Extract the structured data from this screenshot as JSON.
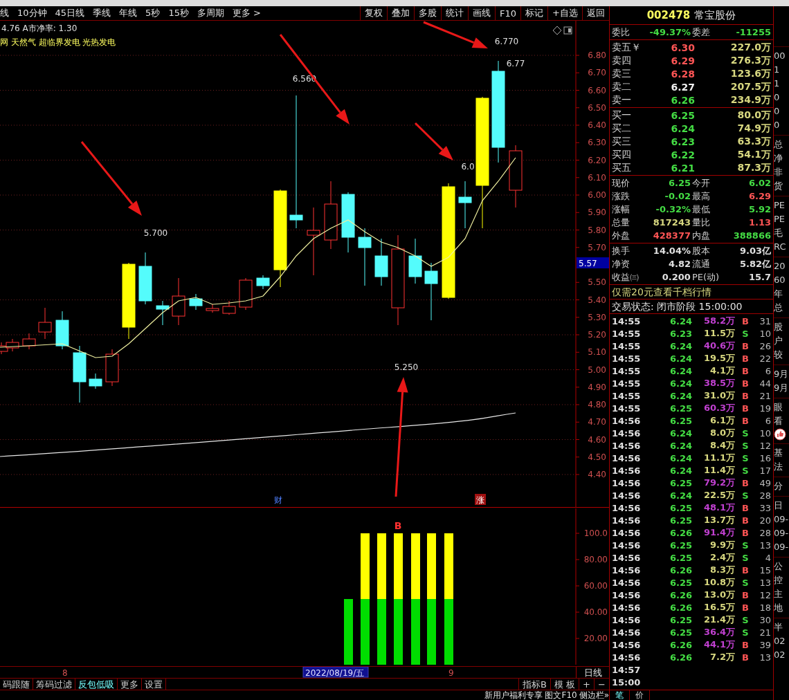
{
  "toolbar": {
    "periods": [
      "线",
      "10分钟",
      "45日线",
      "季线",
      "年线",
      "5秒",
      "15秒",
      "多周期",
      "更多 >"
    ],
    "buttons": [
      "复权",
      "叠加",
      "多股",
      "统计",
      "画线",
      "F10",
      "标记",
      "+自选",
      "返回"
    ]
  },
  "chart": {
    "info_line": "4.76 A市净率: 1.30",
    "concept_line": "网 天然气 超临界发电 光热发电",
    "price_axis": [
      "6.80",
      "6.70",
      "6.60",
      "6.50",
      "6.40",
      "6.30",
      "6.20",
      "6.10",
      "6.00",
      "5.90",
      "5.80",
      "5.70",
      "5.50",
      "5.40",
      "5.30",
      "5.20",
      "5.10",
      "5.00",
      "4.90",
      "4.80",
      "4.70",
      "4.60",
      "4.50",
      "4.40"
    ],
    "current_price_tag": "5.57",
    "annotations": [
      {
        "text": "5.700",
        "kind": "price"
      },
      {
        "text": "6.560",
        "kind": "price"
      },
      {
        "text": "6.770",
        "kind": "price"
      },
      {
        "text": "6.77",
        "kind": "price"
      },
      {
        "text": "6.0",
        "kind": "price"
      },
      {
        "text": "5.250",
        "kind": "price"
      }
    ],
    "event_marks": [
      {
        "text": "财",
        "kind": "info"
      },
      {
        "text": "涨",
        "kind": "alert"
      }
    ]
  },
  "indicator": {
    "signal_mark": "B",
    "axis_labels": [
      "100.0",
      "80.00",
      "60.00",
      "40.00",
      "20.00"
    ]
  },
  "time_axis": {
    "labels": [
      "8",
      "2022/08/19/五",
      "9"
    ],
    "period_button": "日线"
  },
  "bottom_tabs": [
    {
      "label": "码跟随",
      "selected": false
    },
    {
      "label": "筹码过滤",
      "selected": false
    },
    {
      "label": "反包低吸",
      "selected": true
    },
    {
      "label": "更多",
      "selected": false
    },
    {
      "label": "设置",
      "selected": false
    }
  ],
  "bottom_right_buttons": [
    "指标B",
    "模 板",
    "+",
    "−"
  ],
  "footer_links": [
    "新用户福利专享",
    "图文F10",
    "侧边栏»"
  ],
  "quote": {
    "code": "002478",
    "name": "常宝股份",
    "ratio": [
      {
        "label": "委比",
        "value": "-49.37%",
        "color": "#44dd44"
      },
      {
        "label": "委差",
        "value": "-11255",
        "color": "#44dd44"
      }
    ],
    "asks": [
      {
        "label": "卖五￥",
        "price": "6.30",
        "volume": "227.0万",
        "color": "#ff5555"
      },
      {
        "label": "卖四",
        "price": "6.29",
        "volume": "276.3万",
        "color": "#ff5555"
      },
      {
        "label": "卖三",
        "price": "6.28",
        "volume": "123.6万",
        "color": "#ff5555"
      },
      {
        "label": "卖二",
        "price": "6.27",
        "volume": "207.5万",
        "color": "#f0f0f0"
      },
      {
        "label": "卖一",
        "price": "6.26",
        "volume": "234.9万",
        "color": "#44dd44"
      }
    ],
    "bids": [
      {
        "label": "买一",
        "price": "6.25",
        "volume": "80.0万",
        "color": "#44dd44"
      },
      {
        "label": "买二",
        "price": "6.24",
        "volume": "74.9万",
        "color": "#44dd44"
      },
      {
        "label": "买三",
        "price": "6.23",
        "volume": "63.3万",
        "color": "#44dd44"
      },
      {
        "label": "买四",
        "price": "6.22",
        "volume": "54.1万",
        "color": "#44dd44"
      },
      {
        "label": "买五",
        "price": "6.21",
        "volume": "87.3万",
        "color": "#44dd44"
      }
    ],
    "stats": [
      [
        {
          "label": "现价",
          "value": "6.25",
          "color": "#44dd44"
        },
        {
          "label": "今开",
          "value": "6.02",
          "color": "#44dd44"
        }
      ],
      [
        {
          "label": "涨跌",
          "value": "-0.02",
          "color": "#44dd44"
        },
        {
          "label": "最高",
          "value": "6.29",
          "color": "#ff5555"
        }
      ],
      [
        {
          "label": "涨幅",
          "value": "-0.32%",
          "color": "#44dd44"
        },
        {
          "label": "最低",
          "value": "5.92",
          "color": "#44dd44"
        }
      ],
      [
        {
          "label": "总量",
          "value": "817243",
          "color": "#d8d880"
        },
        {
          "label": "量比",
          "value": "1.13",
          "color": "#ff5555"
        }
      ],
      [
        {
          "label": "外盘",
          "value": "428377",
          "color": "#ff5555"
        },
        {
          "label": "内盘",
          "value": "388866",
          "color": "#44dd44"
        }
      ]
    ],
    "fundamentals": [
      [
        {
          "label": "换手",
          "value": "14.04%"
        },
        {
          "label": "股本",
          "value": "9.03亿"
        }
      ],
      [
        {
          "label": "净资",
          "value": "4.82"
        },
        {
          "label": "流通",
          "value": "5.82亿"
        }
      ],
      [
        {
          "label": "收益㈢",
          "value": "0.200"
        },
        {
          "label": "PE(动)",
          "value": "15.7"
        }
      ]
    ],
    "promo": "仅需20元查看千档行情",
    "status": "交易状态: 闭市阶段 15:00:00",
    "ticks": [
      {
        "time": "14:55",
        "price": "6.24",
        "volume": "58.2万",
        "side": "B",
        "kind": "buy",
        "count": "31",
        "large": true
      },
      {
        "time": "14:55",
        "price": "6.23",
        "volume": "11.5万",
        "side": "S",
        "kind": "sell",
        "count": "10",
        "large": false
      },
      {
        "time": "14:55",
        "price": "6.24",
        "volume": "40.6万",
        "side": "B",
        "kind": "buy",
        "count": "26",
        "large": true
      },
      {
        "time": "14:55",
        "price": "6.24",
        "volume": "19.5万",
        "side": "B",
        "kind": "buy",
        "count": "22",
        "large": false
      },
      {
        "time": "14:55",
        "price": "6.24",
        "volume": "4.1万",
        "side": "B",
        "kind": "buy",
        "count": "6",
        "large": false
      },
      {
        "time": "14:55",
        "price": "6.24",
        "volume": "38.5万",
        "side": "B",
        "kind": "buy",
        "count": "44",
        "large": true
      },
      {
        "time": "14:55",
        "price": "6.24",
        "volume": "31.0万",
        "side": "B",
        "kind": "buy",
        "count": "21",
        "large": false
      },
      {
        "time": "14:55",
        "price": "6.25",
        "volume": "60.3万",
        "side": "B",
        "kind": "buy",
        "count": "19",
        "large": true
      },
      {
        "time": "14:56",
        "price": "6.25",
        "volume": "6.1万",
        "side": "B",
        "kind": "buy",
        "count": "6",
        "large": false
      },
      {
        "time": "14:56",
        "price": "6.24",
        "volume": "8.0万",
        "side": "S",
        "kind": "sell",
        "count": "10",
        "large": false
      },
      {
        "time": "14:56",
        "price": "6.24",
        "volume": "8.4万",
        "side": "S",
        "kind": "sell",
        "count": "12",
        "large": false
      },
      {
        "time": "14:56",
        "price": "6.24",
        "volume": "11.1万",
        "side": "S",
        "kind": "sell",
        "count": "16",
        "large": false
      },
      {
        "time": "14:56",
        "price": "6.24",
        "volume": "11.4万",
        "side": "S",
        "kind": "sell",
        "count": "17",
        "large": false
      },
      {
        "time": "14:56",
        "price": "6.25",
        "volume": "79.2万",
        "side": "B",
        "kind": "buy",
        "count": "49",
        "large": true
      },
      {
        "time": "14:56",
        "price": "6.24",
        "volume": "22.5万",
        "side": "S",
        "kind": "sell",
        "count": "28",
        "large": false
      },
      {
        "time": "14:56",
        "price": "6.25",
        "volume": "48.1万",
        "side": "B",
        "kind": "buy",
        "count": "33",
        "large": true
      },
      {
        "time": "14:56",
        "price": "6.25",
        "volume": "13.7万",
        "side": "B",
        "kind": "buy",
        "count": "20",
        "large": false
      },
      {
        "time": "14:56",
        "price": "6.26",
        "volume": "91.4万",
        "side": "B",
        "kind": "buy",
        "count": "28",
        "large": true
      },
      {
        "time": "14:56",
        "price": "6.25",
        "volume": "9.9万",
        "side": "S",
        "kind": "sell",
        "count": "13",
        "large": false
      },
      {
        "time": "14:56",
        "price": "6.25",
        "volume": "2.4万",
        "side": "S",
        "kind": "sell",
        "count": "4",
        "large": false
      },
      {
        "time": "14:56",
        "price": "6.26",
        "volume": "8.3万",
        "side": "B",
        "kind": "buy",
        "count": "15",
        "large": false
      },
      {
        "time": "14:56",
        "price": "6.25",
        "volume": "10.8万",
        "side": "S",
        "kind": "sell",
        "count": "13",
        "large": false
      },
      {
        "time": "14:56",
        "price": "6.26",
        "volume": "13.0万",
        "side": "B",
        "kind": "buy",
        "count": "12",
        "large": false
      },
      {
        "time": "14:56",
        "price": "6.26",
        "volume": "16.5万",
        "side": "B",
        "kind": "buy",
        "count": "18",
        "large": false
      },
      {
        "time": "14:56",
        "price": "6.25",
        "volume": "21.4万",
        "side": "S",
        "kind": "sell",
        "count": "30",
        "large": false
      },
      {
        "time": "14:56",
        "price": "6.25",
        "volume": "36.4万",
        "side": "S",
        "kind": "sell",
        "count": "21",
        "large": true
      },
      {
        "time": "14:56",
        "price": "6.26",
        "volume": "44.1万",
        "side": "B",
        "kind": "buy",
        "count": "39",
        "large": true
      },
      {
        "time": "14:56",
        "price": "6.26",
        "volume": "7.2万",
        "side": "B",
        "kind": "buy",
        "count": "13",
        "large": false
      },
      {
        "time": "14:57"
      },
      {
        "time": "15:00"
      }
    ],
    "bottom_tabs": [
      {
        "label": "笔",
        "selected": true
      },
      {
        "label": "价",
        "selected": false
      }
    ]
  },
  "side_strip": [
    {
      "kind": "plain",
      "items": [
        "00",
        "1",
        "1",
        "0",
        "0",
        "0"
      ]
    },
    {
      "kind": "plain",
      "items": [
        "总",
        "净",
        "非",
        "货"
      ]
    },
    {
      "kind": "plain",
      "items": [
        "PE",
        "PE",
        "毛",
        "RC"
      ]
    },
    {
      "kind": "plain",
      "items": [
        "20",
        "60",
        "年",
        "总"
      ]
    },
    {
      "kind": "plain",
      "items": [
        "股",
        "户",
        "较"
      ]
    },
    {
      "kind": "plain",
      "items": [
        "9月",
        "9月"
      ]
    },
    {
      "kind": "with-icon",
      "items": [
        "眼",
        "看"
      ]
    },
    {
      "kind": "plain",
      "items": [
        "基",
        "法"
      ]
    },
    {
      "kind": "plain",
      "items": [
        "分"
      ]
    },
    {
      "kind": "plain",
      "items": [
        "日",
        "09-",
        "09-",
        "09-"
      ]
    },
    {
      "kind": "plain",
      "items": [
        "公",
        "控",
        "主",
        "地"
      ]
    },
    {
      "kind": "plain",
      "items": [
        "半",
        "02",
        "02"
      ]
    }
  ]
}
